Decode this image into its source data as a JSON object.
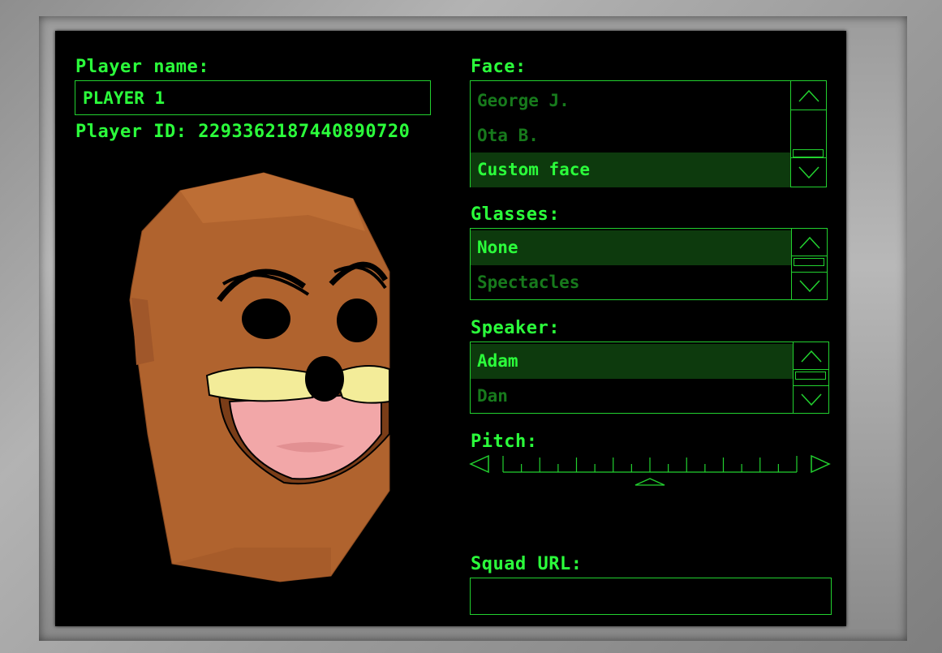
{
  "player": {
    "name_label": "Player name:",
    "name_value": "PLAYER 1",
    "id_label": "Player ID:",
    "id_value": "2293362187440890720"
  },
  "face": {
    "label": "Face:",
    "options": [
      "George J.",
      "Ota B.",
      "Custom face"
    ],
    "selected": "Custom face"
  },
  "glasses": {
    "label": "Glasses:",
    "options": [
      "None",
      "Spectacles"
    ],
    "selected": "None"
  },
  "speaker": {
    "label": "Speaker:",
    "options": [
      "Adam",
      "Dan"
    ],
    "selected": "Adam"
  },
  "pitch": {
    "label": "Pitch:",
    "value": 0.5
  },
  "squad": {
    "label": "Squad URL:",
    "value": ""
  },
  "colors": {
    "text_bright": "#2bff3b",
    "text_dim": "#177a1c",
    "selection_bg": "#0d3a0d",
    "border": "#22d12f",
    "skin": "#b0632e"
  },
  "icons": [
    "up-arrow-icon",
    "down-arrow-icon",
    "left-arrow-icon",
    "right-arrow-icon",
    "pitch-indicator-icon"
  ]
}
